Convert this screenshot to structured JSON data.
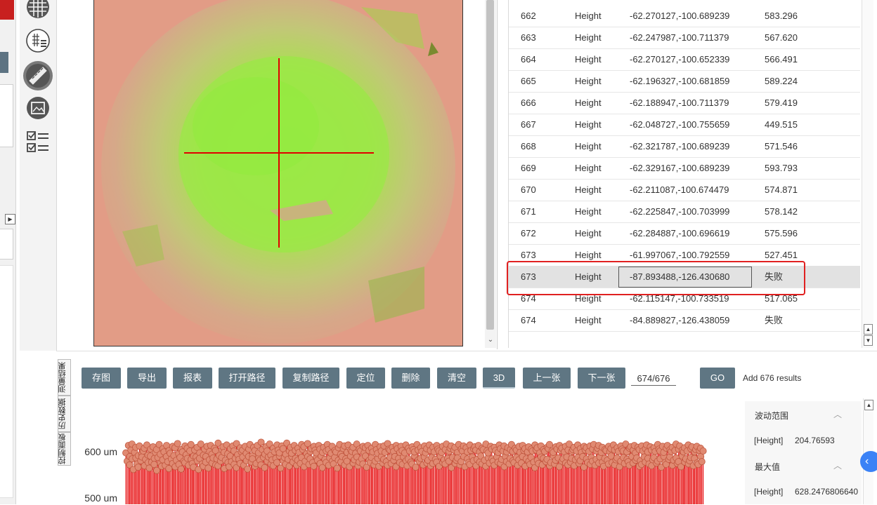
{
  "results_table": {
    "rows": [
      {
        "id": "662",
        "type": "Height",
        "coord": "-62.270127,-100.689239",
        "value": "583.296",
        "status": "normal"
      },
      {
        "id": "663",
        "type": "Height",
        "coord": "-62.247987,-100.711379",
        "value": "567.620",
        "status": "normal"
      },
      {
        "id": "664",
        "type": "Height",
        "coord": "-62.270127,-100.652339",
        "value": "566.491",
        "status": "normal"
      },
      {
        "id": "665",
        "type": "Height",
        "coord": "-62.196327,-100.681859",
        "value": "589.224",
        "status": "normal"
      },
      {
        "id": "666",
        "type": "Height",
        "coord": "-62.188947,-100.711379",
        "value": "579.419",
        "status": "normal"
      },
      {
        "id": "667",
        "type": "Height",
        "coord": "-62.048727,-100.755659",
        "value": "449.515",
        "status": "normal"
      },
      {
        "id": "668",
        "type": "Height",
        "coord": "-62.321787,-100.689239",
        "value": "571.546",
        "status": "normal"
      },
      {
        "id": "669",
        "type": "Height",
        "coord": "-62.329167,-100.689239",
        "value": "593.793",
        "status": "normal"
      },
      {
        "id": "670",
        "type": "Height",
        "coord": "-62.211087,-100.674479",
        "value": "574.871",
        "status": "normal"
      },
      {
        "id": "671",
        "type": "Height",
        "coord": "-62.225847,-100.703999",
        "value": "578.142",
        "status": "normal"
      },
      {
        "id": "672",
        "type": "Height",
        "coord": "-62.284887,-100.696619",
        "value": "575.596",
        "status": "normal"
      },
      {
        "id": "673",
        "type": "Height",
        "coord": "-61.997067,-100.792559",
        "value": "527.451",
        "status": "normal"
      },
      {
        "id": "673",
        "type": "Height",
        "coord": "-87.893488,-126.430680",
        "value": "失败",
        "status": "selected"
      },
      {
        "id": "674",
        "type": "Height",
        "coord": "-62.115147,-100.733519",
        "value": "517.065",
        "status": "normal"
      },
      {
        "id": "674",
        "type": "Height",
        "coord": "-84.889827,-126.438059",
        "value": "失败",
        "status": "normal"
      }
    ]
  },
  "toolbar": {
    "save_image": "存图",
    "export": "导出",
    "report": "报表",
    "open_path": "打开路径",
    "copy_path": "复制路径",
    "locate": "定位",
    "delete": "删除",
    "clear": "清空",
    "view_3d": "3D",
    "prev": "上一张",
    "next": "下一张",
    "page": "674/676",
    "go": "GO",
    "status": "Add 676 results"
  },
  "side_tabs": {
    "results": "测量结果",
    "history": "历史数据",
    "control": "控制面板"
  },
  "stats": {
    "range_label": "波动范围",
    "range_key": "[Height]",
    "range_value": "204.76593",
    "max_label": "最大值",
    "max_key": "[Height]",
    "max_value": "628.2476806640"
  },
  "icons": {
    "tool_1": "grid-icon",
    "tool_2": "grid-list-icon",
    "tool_3": "measure-ruler-icon",
    "tool_4": "image-frame-icon",
    "tool_5": "checklist-icon"
  },
  "colors": {
    "button": "#5f7683",
    "highlight": "#e02020",
    "chart_mark": "#e8191b",
    "chart_marker": "#e08a72",
    "assist": "#3b82f6"
  },
  "chart_data": {
    "type": "scatter",
    "title": "",
    "xlabel": "",
    "ylabel": "",
    "y_unit": "um",
    "ytick_labels": [
      "600 um",
      "500 um"
    ],
    "yticks": [
      600,
      500
    ],
    "ylim": [
      470,
      660
    ],
    "x_range": [
      0,
      676
    ],
    "series": [
      {
        "values": [
          596,
          578,
          612,
          588,
          570,
          602,
          583,
          615,
          560,
          597,
          585,
          608,
          572,
          590,
          565,
          611,
          579,
          594,
          587,
          600,
          568,
          606,
          582,
          613,
          575,
          591,
          563,
          604,
          589,
          576,
          609,
          584,
          571,
          597,
          558,
          603,
          586,
          614,
          574,
          593,
          567,
          605,
          581,
          598,
          569,
          612,
          588,
          577,
          601,
          562,
          595,
          583,
          610,
          573,
          590,
          566,
          607,
          580,
          616,
          571,
          594,
          586,
          603,
          561,
          598,
          578,
          611,
          575,
          592,
          584,
          606,
          569,
          600,
          582,
          614,
          573,
          589,
          565,
          602,
          587,
          579,
          608,
          560,
          596,
          584,
          615,
          572,
          591,
          567,
          604,
          588,
          576,
          610,
          563,
          599,
          581,
          612,
          574,
          593,
          585,
          606,
          570,
          601,
          583,
          617,
          568,
          590,
          578,
          603,
          586,
          609,
          562,
          597,
          580,
          613,
          575,
          594,
          566,
          605,
          589,
          577,
          611,
          571,
          600,
          584,
          616,
          564,
          592,
          582,
          607,
          573,
          598,
          587,
          602,
          569,
          610,
          579,
          595,
          561,
          604,
          588,
          614,
          576,
          590,
          583,
          608,
          567,
          601,
          573,
          612,
          585,
          596,
          580,
          619,
          570,
          603,
          586,
          593,
          564,
          609,
          578,
          600,
          587,
          615,
          572,
          591,
          581,
          606,
          568,
          598,
          584,
          613,
          575,
          602,
          589,
          596,
          563,
          611,
          579,
          605,
          586,
          593,
          571,
          617,
          582,
          600,
          567,
          608,
          588,
          595,
          576,
          612,
          584,
          601,
          569,
          606,
          580,
          597,
          573,
          614,
          586,
          603,
          566,
          609,
          578,
          594,
          588,
          616,
          571,
          599,
          583,
          605,
          575,
          610,
          567,
          602,
          587,
          596,
          580,
          612,
          573,
          604,
          589,
          597,
          564,
          608,
          582,
          600,
          575,
          614,
          569,
          603,
          585,
          595,
          578,
          610,
          572,
          601,
          586,
          598,
          563,
          607,
          580,
          614,
          576,
          593,
          588,
          605,
          570,
          611,
          583,
          597,
          578,
          613,
          566,
          602,
          589,
          599,
          574,
          608,
          581,
          595,
          587,
          615,
          568,
          604,
          576,
          600,
          583,
          610,
          572,
          596,
          589,
          607,
          565,
          612,
          580,
          601,
          575,
          606,
          586,
          598,
          570,
          614,
          578,
          603,
          584,
          595,
          567,
          609,
          588,
          600,
          574,
          611,
          582,
          597,
          577,
          616,
          569,
          604,
          586,
          602,
          573,
          608,
          580,
          599,
          588,
          612,
          566,
          605,
          584,
          597,
          575,
          610,
          571,
          601,
          587,
          596,
          579,
          613,
          568,
          606,
          583,
          600,
          576,
          609,
          572,
          603,
          589,
          598,
          565,
          614,
          581,
          602,
          577,
          607,
          584,
          599,
          570,
          611,
          587,
          596,
          574,
          605,
          580,
          613,
          568,
          601,
          586,
          608,
          573,
          598,
          582,
          612,
          576,
          604,
          567,
          600,
          589,
          597,
          575,
          610,
          581,
          603,
          572,
          615,
          584,
          599,
          578,
          606,
          564,
          611,
          586,
          602,
          573,
          608,
          580,
          597,
          585,
          614,
          570,
          604,
          577,
          600,
          588,
          611,
          566,
          607,
          583,
          598,
          575,
          613,
          571,
          601,
          587,
          605,
          579,
          609,
          568,
          602,
          582,
          612,
          576,
          598,
          589,
          606,
          572,
          603,
          580,
          615,
          567,
          600,
          585,
          596,
          574,
          610,
          583,
          604,
          578,
          608,
          569,
          601,
          587,
          597,
          576,
          613,
          573,
          605,
          582,
          600,
          566,
          611,
          588,
          598,
          577,
          607,
          572,
          603,
          584,
          614,
          579,
          599,
          575,
          606,
          586,
          602,
          569,
          610,
          581,
          597,
          574,
          612,
          588,
          601,
          567,
          605,
          583,
          598,
          578,
          609,
          571,
          604,
          586,
          600,
          576,
          613,
          564,
          602,
          580,
          607,
          573,
          596,
          587,
          611,
          570,
          603,
          584,
          599,
          577,
          608,
          582,
          605,
          568,
          614,
          575,
          600,
          589,
          597,
          572,
          609,
          580,
          604,
          585,
          612,
          566,
          601,
          578,
          606,
          583,
          598,
          574,
          610,
          587,
          602,
          570,
          615,
          576,
          599,
          584,
          603,
          568,
          608,
          581,
          600,
          586,
          613,
          573,
          605,
          579,
          597,
          588,
          610,
          565,
          602,
          583,
          607,
          575,
          599,
          571,
          611,
          586,
          604,
          578,
          614,
          569,
          600,
          582,
          606,
          574,
          612,
          587,
          597,
          576,
          608,
          567,
          603,
          584,
          601,
          580,
          610,
          572,
          598,
          589,
          605,
          575,
          613,
          570,
          602,
          581,
          607,
          585,
          599,
          566,
          611,
          578,
          604,
          586,
          600,
          573,
          615,
          582,
          598,
          577,
          606,
          569,
          609,
          588,
          602,
          574,
          612,
          580,
          596,
          585,
          608,
          567,
          603,
          579,
          611,
          571,
          600,
          587,
          605,
          576,
          613,
          584,
          598,
          572,
          609,
          568,
          602,
          581,
          607,
          586,
          599,
          574,
          614,
          578,
          604,
          583,
          600,
          565,
          610,
          588,
          597,
          575,
          606,
          571,
          612,
          582,
          603,
          587,
          599,
          569,
          608,
          580,
          601,
          585,
          615,
          573,
          604,
          577,
          611,
          566,
          602,
          589,
          598,
          576,
          607,
          583,
          600,
          572,
          613,
          579,
          605,
          586,
          609,
          568,
          598,
          584,
          603,
          574,
          610,
          571,
          601,
          588,
          606,
          577,
          600
        ],
        "units": "um"
      }
    ]
  }
}
